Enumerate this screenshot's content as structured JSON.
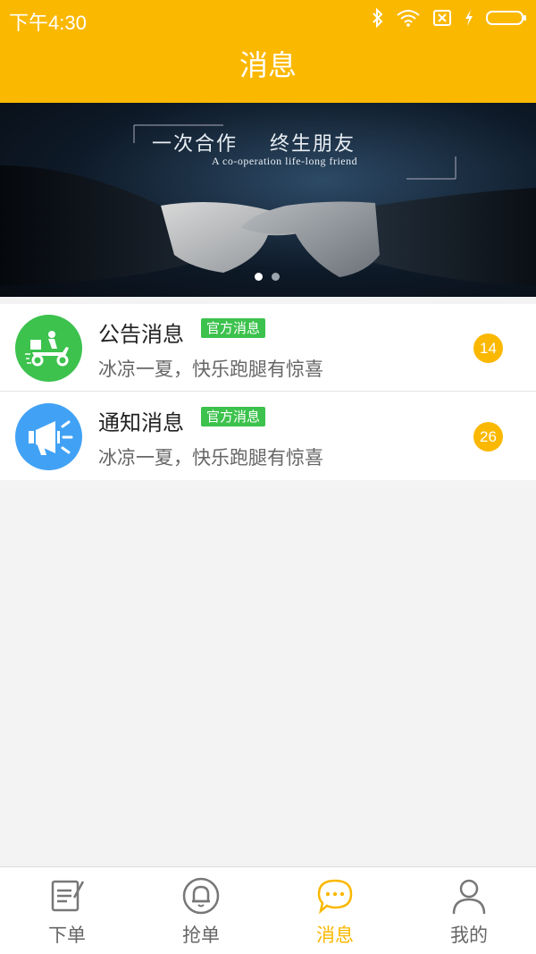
{
  "status_bar": {
    "time": "下午4:30"
  },
  "header": {
    "title": "消息"
  },
  "banner": {
    "title": "一次合作    终生朋友",
    "subtitle": "A co-operation life-long friend",
    "slides_total": 2,
    "active_slide": 1
  },
  "messages": [
    {
      "title": "公告消息",
      "tag": "官方消息",
      "preview": "冰凉一夏，快乐跑腿有惊喜",
      "count": "14",
      "icon": "delivery-scooter-icon",
      "icon_color": "#3cc24d"
    },
    {
      "title": "通知消息",
      "tag": "官方消息",
      "preview": "冰凉一夏，快乐跑腿有惊喜",
      "count": "26",
      "icon": "megaphone-icon",
      "icon_color": "#41a2f5"
    }
  ],
  "nav": {
    "items": [
      {
        "label": "下单",
        "icon": "order-form-icon"
      },
      {
        "label": "抢单",
        "icon": "bell-icon"
      },
      {
        "label": "消息",
        "icon": "chat-bubble-icon"
      },
      {
        "label": "我的",
        "icon": "person-icon"
      }
    ],
    "active": "消息"
  },
  "colors": {
    "brand": "#fbb801",
    "tag_green": "#3cc24d",
    "badge": "#fbb801"
  }
}
